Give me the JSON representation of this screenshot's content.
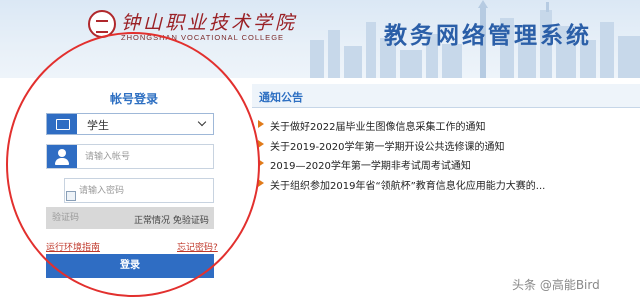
{
  "header": {
    "school_name_cn": "钟山职业技术学院",
    "school_name_en": "ZHONGSHAN VOCATIONAL COLLEGE",
    "system_title": "教务网络管理系统"
  },
  "login": {
    "title": "帐号登录",
    "role_selected": "学生",
    "username_placeholder": "请输入帐号",
    "password_placeholder": "请输入密码",
    "captcha_placeholder": "验证码",
    "captcha_status": "正常情况 免验证码",
    "runtime_link": "运行环境指南",
    "forgot_link": "忘记密码?",
    "login_button": "登录"
  },
  "notices": {
    "title": "通知公告",
    "items": [
      "关于做好2022届毕业生图像信息采集工作的通知",
      "关于2019-2020学年第一学期开设公共选修课的通知",
      "2019—2020学年第一学期非考试周考试通知",
      "关于组织参加2019年省“领航杯”教育信息化应用能力大赛的..."
    ]
  },
  "watermark": "头条 @高能Bird",
  "colors": {
    "accent_blue": "#2f6dc3",
    "title_blue": "#2b5fa8",
    "annotation_red": "#e2302e",
    "link_red": "#c0392b",
    "bullet_orange": "#e07a1a"
  },
  "icons": {
    "role_icon": "id-card-icon",
    "user_icon": "user-icon",
    "bullet_icon": "triangle-bullet-icon"
  }
}
